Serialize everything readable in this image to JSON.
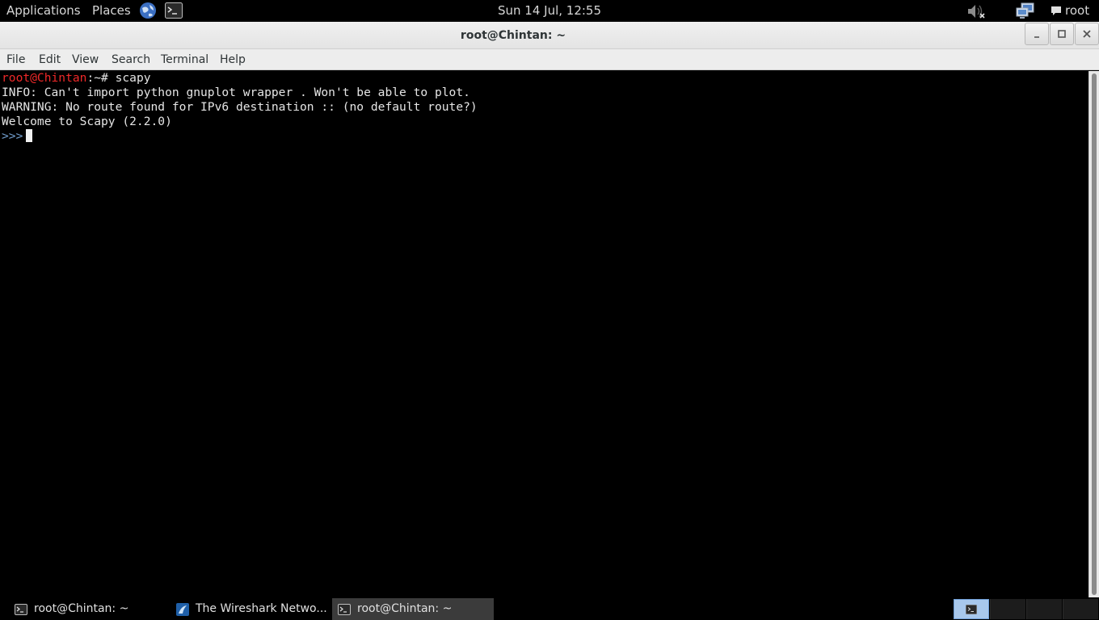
{
  "top_panel": {
    "applications": "Applications",
    "places": "Places",
    "clock": "Sun 14 Jul, 12:55",
    "user": "root"
  },
  "window": {
    "title": "root@Chintan: ~"
  },
  "menu": {
    "file": "File",
    "edit": "Edit",
    "view": "View",
    "search": "Search",
    "terminal": "Terminal",
    "help": "Help"
  },
  "terminal": {
    "prompt_user": "root@Chintan",
    "prompt_path": ":~# ",
    "command": "scapy",
    "line2": "INFO: Can't import python gnuplot wrapper . Won't be able to plot.",
    "line3": "WARNING: No route found for IPv6 destination :: (no default route?)",
    "line4": "Welcome to Scapy (2.2.0)",
    "py_prompt": ">>>"
  },
  "taskbar": {
    "task1": "root@Chintan: ~",
    "task2": "The Wireshark Netwo...",
    "task3": "root@Chintan: ~"
  }
}
